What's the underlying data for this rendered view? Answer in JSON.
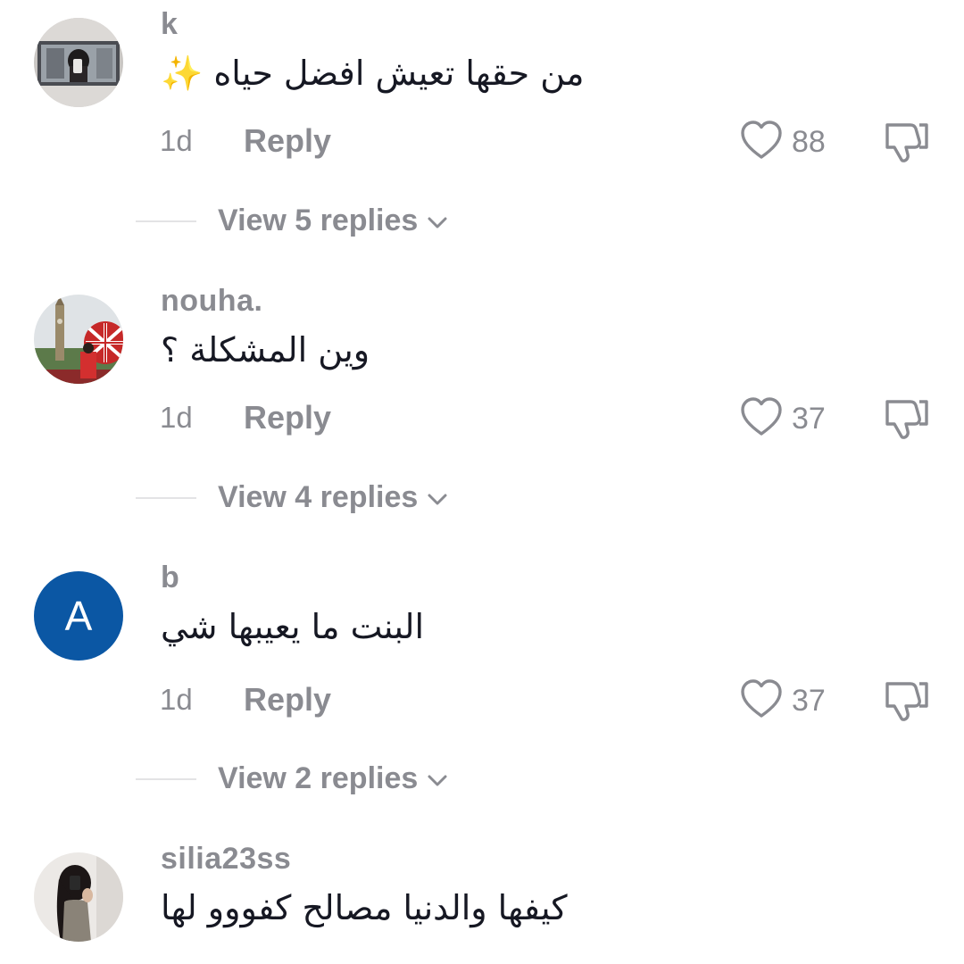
{
  "comments": [
    {
      "username": "k",
      "text": "من حقها تعيش افضل حياه ✨",
      "time": "1d",
      "reply_label": "Reply",
      "likes": "88",
      "view_replies": "View 5 replies",
      "avatar": "photo-car-selfie"
    },
    {
      "username": "nouha.",
      "text": "وين المشكلة ؟",
      "time": "1d",
      "reply_label": "Reply",
      "likes": "37",
      "view_replies": "View 4 replies",
      "avatar": "photo-london"
    },
    {
      "username": "b",
      "text": "البنت ما يعيبها شي",
      "time": "1d",
      "reply_label": "Reply",
      "likes": "37",
      "view_replies": "View 2 replies",
      "avatar_letter": "A",
      "avatar_color": "#0b57a4"
    },
    {
      "username": "silia23ss",
      "text": "كيفها والدنيا مصالح كفووو لها",
      "avatar": "photo-mirror-selfie"
    }
  ],
  "colors": {
    "secondary_text": "#8a8b91",
    "primary_text": "#161823",
    "divider": "#e3e3e5"
  },
  "icons": [
    "heart-outline-icon",
    "thumbs-down-outline-icon",
    "chevron-down-icon"
  ]
}
